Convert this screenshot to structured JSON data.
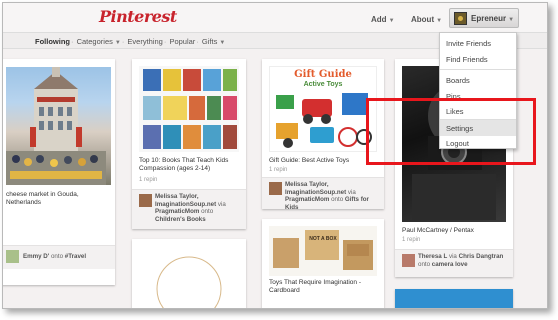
{
  "header": {
    "logo": "Pinterest",
    "add_label": "Add",
    "about_label": "About",
    "user_name": "Epreneur"
  },
  "subnav": {
    "items": [
      "Following",
      "Categories",
      "Everything",
      "Popular",
      "Gifts"
    ]
  },
  "dropdown": {
    "items": [
      "Invite Friends",
      "Find Friends",
      "Boards",
      "Pins",
      "Likes",
      "Settings",
      "Logout"
    ],
    "highlighted": "Settings"
  },
  "pins": [
    {
      "desc": "cheese market in Gouda, Netherlands",
      "repin": "",
      "user": "Emmy D'",
      "board": "#Travel",
      "via": ""
    },
    {
      "desc": "Top 10: Books That Teach Kids Compassion (ages 2-14)",
      "repin": "1 repin",
      "user": "Melissa Taylor,",
      "via": "PragmaticMom",
      "via_line1": "ImaginationSoup.net",
      "board": "Children's Books"
    },
    {
      "desc": "Gift Guide: Best Active Toys",
      "repin": "1 repin",
      "user": "Melissa Taylor,",
      "via_line1": "ImaginationSoup.net",
      "via": "PragmaticMom",
      "board": "Gifts for Kids"
    },
    {
      "desc": "Toys That Require Imagination - Cardboard",
      "repin": ""
    },
    {
      "desc": "Paul McCartney / Pentax",
      "repin": "1 repin",
      "user": "Theresa L",
      "via": "Chris Dangtran",
      "board": "camera love"
    }
  ],
  "gift_guide_image_title": "Gift Guide",
  "gift_guide_image_subtitle": "Active Toys",
  "cardboard_image_text": "NOT A BOX",
  "connector_onto": "onto",
  "connector_via": "via",
  "highlight_color": "#e8161c",
  "brand_color": "#c8232c"
}
